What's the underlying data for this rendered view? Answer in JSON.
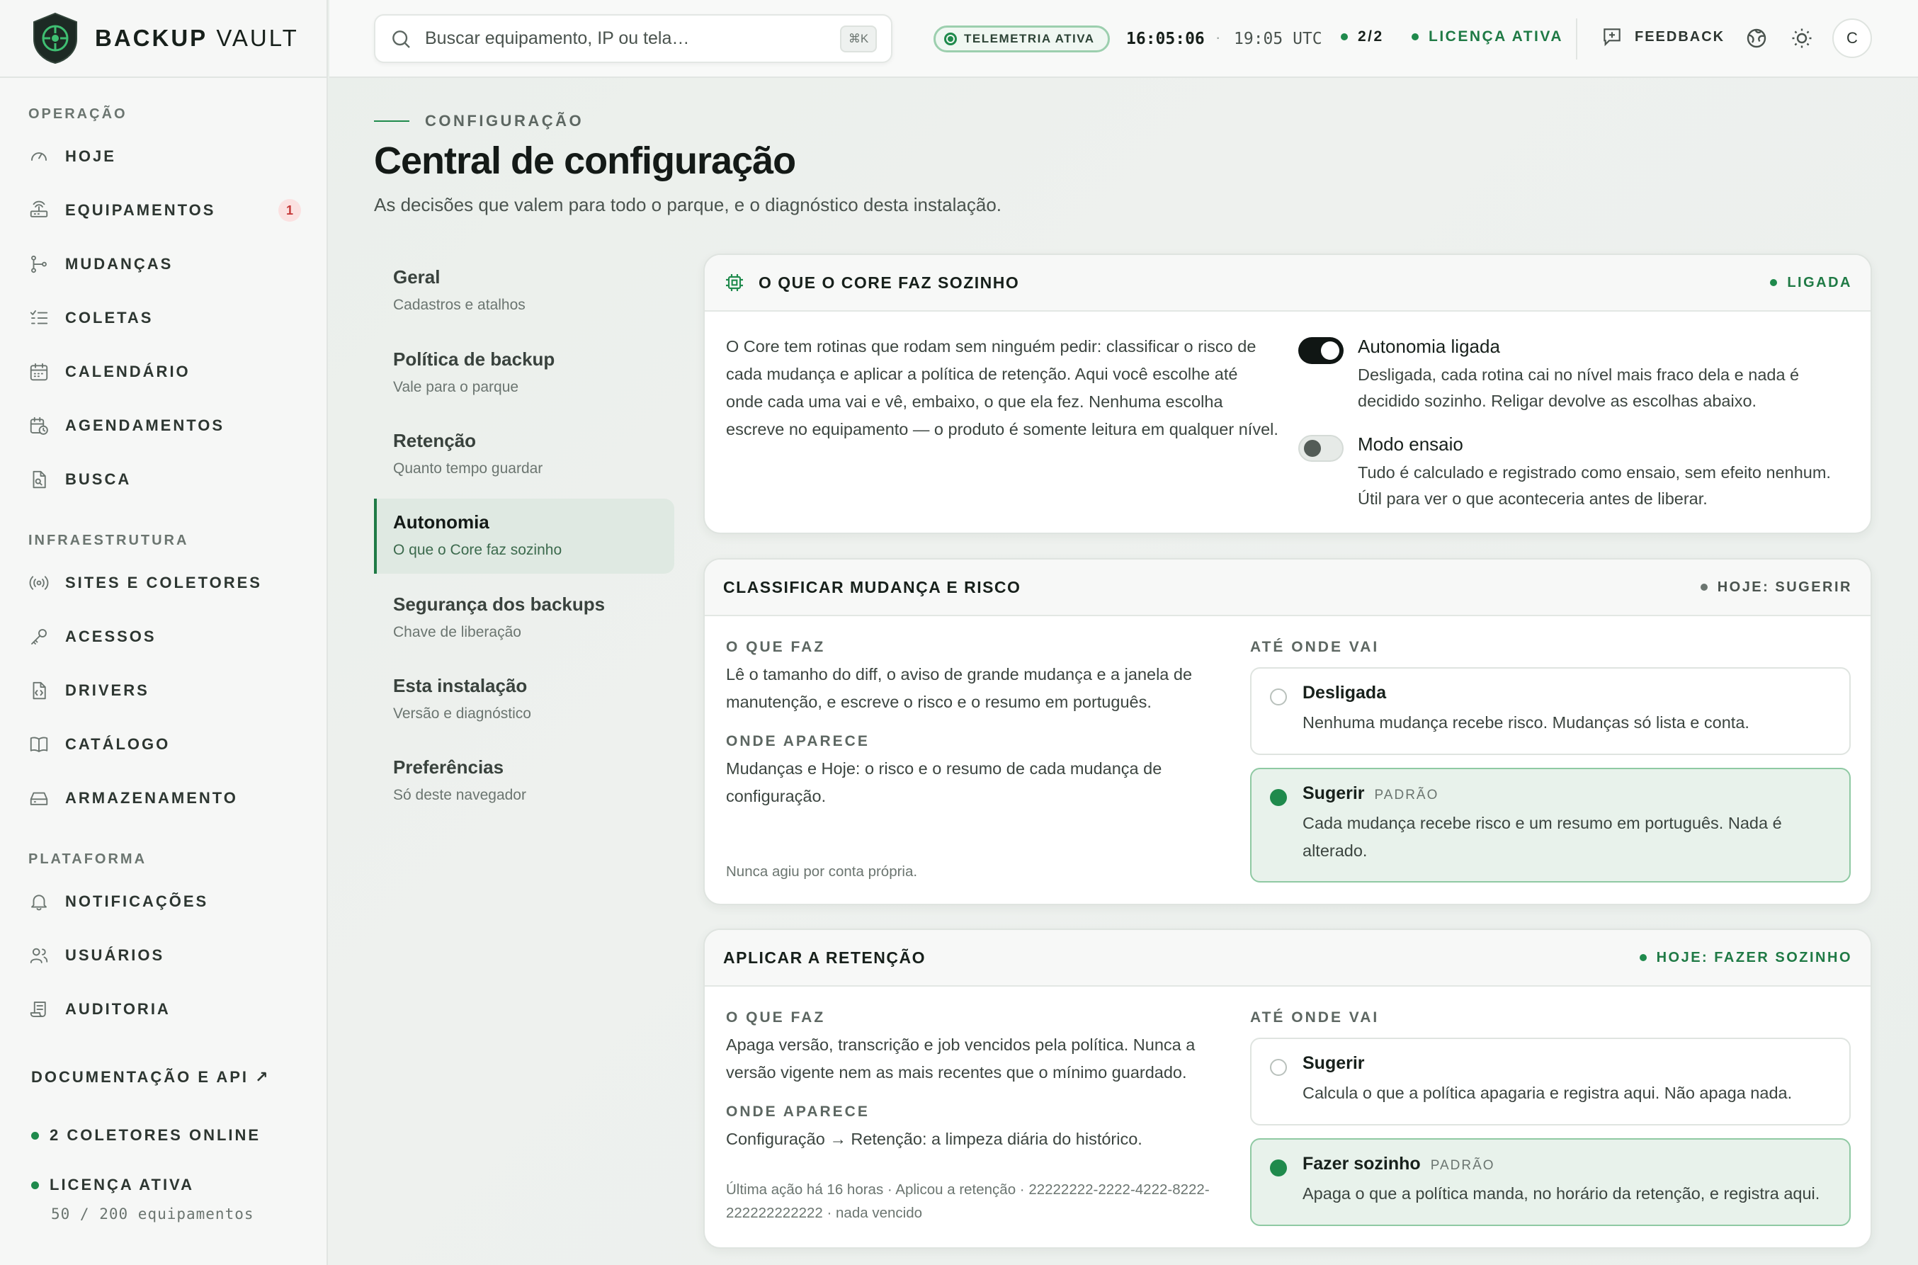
{
  "brand": {
    "name_bold": "BACKUP",
    "name_light": "VAULT"
  },
  "sidebar": {
    "sections": {
      "operacao": "OPERAÇÃO",
      "infra": "INFRAESTRUTURA",
      "plataforma": "PLATAFORMA"
    },
    "items": [
      {
        "label": "HOJE",
        "icon": "gauge-icon"
      },
      {
        "label": "EQUIPAMENTOS",
        "icon": "router-icon",
        "badge": "1"
      },
      {
        "label": "MUDANÇAS",
        "icon": "git-branch-icon"
      },
      {
        "label": "COLETAS",
        "icon": "checklist-icon"
      },
      {
        "label": "CALENDÁRIO",
        "icon": "calendar-icon"
      },
      {
        "label": "AGENDAMENTOS",
        "icon": "calendar-clock-icon"
      },
      {
        "label": "BUSCA",
        "icon": "file-search-icon"
      },
      {
        "label": "SITES E COLETORES",
        "icon": "radio-icon"
      },
      {
        "label": "ACESSOS",
        "icon": "key-icon"
      },
      {
        "label": "DRIVERS",
        "icon": "file-code-icon"
      },
      {
        "label": "CATÁLOGO",
        "icon": "book-icon"
      },
      {
        "label": "ARMAZENAMENTO",
        "icon": "hard-drive-icon"
      },
      {
        "label": "NOTIFICAÇÕES",
        "icon": "bell-icon"
      },
      {
        "label": "USUÁRIOS",
        "icon": "users-icon"
      },
      {
        "label": "AUDITORIA",
        "icon": "scroll-icon"
      }
    ],
    "docs_link": "DOCUMENTAÇÃO E API ↗",
    "collectors_status": "2 COLETORES ONLINE",
    "license_status": "LICENÇA ATIVA",
    "license_usage": "50 / 200 equipamentos"
  },
  "topbar": {
    "search_placeholder": "Buscar equipamento, IP ou tela…",
    "search_shortcut": "⌘K",
    "telemetry": "TELEMETRIA ATIVA",
    "local_time": "16:05:06",
    "separator": "·",
    "utc_time": "19:05 UTC",
    "collectors": "2/2",
    "license": "LICENÇA ATIVA",
    "feedback": "FEEDBACK",
    "avatar_initial": "C"
  },
  "page": {
    "eyebrow": "CONFIGURAÇÃO",
    "title": "Central de configuração",
    "subtitle": "As decisões que valem para todo o parque, e o diagnóstico desta instalação."
  },
  "settings_nav": [
    {
      "title": "Geral",
      "sub": "Cadastros e atalhos"
    },
    {
      "title": "Política de backup",
      "sub": "Vale para o parque"
    },
    {
      "title": "Retenção",
      "sub": "Quanto tempo guardar"
    },
    {
      "title": "Autonomia",
      "sub": "O que o Core faz sozinho",
      "active": true
    },
    {
      "title": "Segurança dos backups",
      "sub": "Chave de liberação"
    },
    {
      "title": "Esta instalação",
      "sub": "Versão e diagnóstico"
    },
    {
      "title": "Preferências",
      "sub": "Só deste navegador"
    }
  ],
  "autonomy_card": {
    "title": "O QUE O CORE FAZ SOZINHO",
    "status": "LIGADA",
    "description": "O Core tem rotinas que rodam sem ninguém pedir: classificar o risco de cada mudança e aplicar a política de retenção. Aqui você escolhe até onde cada uma vai e vê, embaixo, o que ela fez. Nenhuma escolha escreve no equipamento — o produto é somente leitura em qualquer nível.",
    "toggle_autonomy": {
      "title": "Autonomia ligada",
      "desc": "Desligada, cada rotina cai no nível mais fraco dela e nada é decidido sozinho. Religar devolve as escolhas abaixo.",
      "on": true
    },
    "toggle_dryrun": {
      "title": "Modo ensaio",
      "desc": "Tudo é calculado e registrado como ensaio, sem efeito nenhum. Útil para ver o que aconteceria antes de liberar.",
      "on": false
    }
  },
  "classify_card": {
    "title": "CLASSIFICAR MUDANÇA E RISCO",
    "status": "HOJE: SUGERIR",
    "what_label": "O QUE FAZ",
    "what_text": "Lê o tamanho do diff, o aviso de grande mudança e a janela de manutenção, e escreve o risco e o resumo em português.",
    "where_label": "ONDE APARECE",
    "where_text": "Mudanças e Hoje: o risco e o resumo de cada mudança de configuração.",
    "meta": "Nunca agiu por conta própria.",
    "range_label": "ATÉ ONDE VAI",
    "options": [
      {
        "title": "Desligada",
        "tag": "",
        "desc": "Nenhuma mudança recebe risco. Mudanças só lista e conta.",
        "selected": false
      },
      {
        "title": "Sugerir",
        "tag": "PADRÃO",
        "desc": "Cada mudança recebe risco e um resumo em português. Nada é alterado.",
        "selected": true
      }
    ]
  },
  "retention_card": {
    "title": "APLICAR A RETENÇÃO",
    "status": "HOJE: FAZER SOZINHO",
    "what_label": "O QUE FAZ",
    "what_text": "Apaga versão, transcrição e job vencidos pela política. Nunca a versão vigente nem as mais recentes que o mínimo guardado.",
    "where_label": "ONDE APARECE",
    "where_text": "Configuração → Retenção: a limpeza diária do histórico.",
    "meta": "Última ação há 16 horas · Aplicou a retenção · 22222222-2222-4222-8222-222222222222 · nada vencido",
    "range_label": "ATÉ ONDE VAI",
    "options": [
      {
        "title": "Sugerir",
        "tag": "",
        "desc": "Calcula o que a política apagaria e registra aqui. Não apaga nada.",
        "selected": false
      },
      {
        "title": "Fazer sozinho",
        "tag": "PADRÃO",
        "desc": "Apaga o que a política manda, no horário da retenção, e registra aqui.",
        "selected": true
      }
    ]
  },
  "colors": {
    "accent": "#1f8a4c",
    "badge_bg": "#fbe1e1",
    "badge_fg": "#c53a3a",
    "selected_bg": "#e8f2eb"
  }
}
